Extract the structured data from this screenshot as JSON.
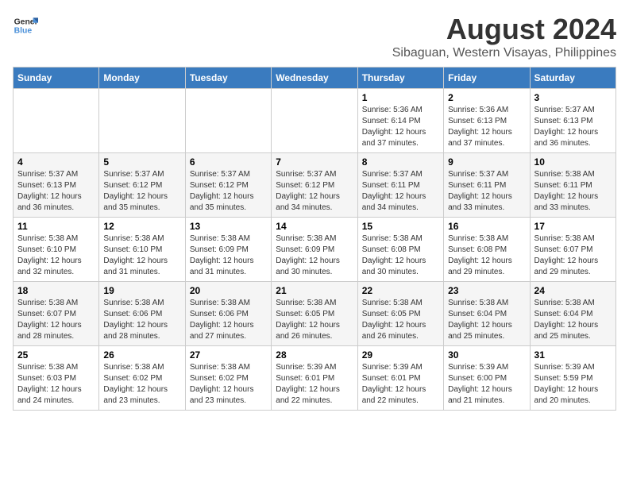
{
  "header": {
    "logo_line1": "General",
    "logo_line2": "Blue",
    "main_title": "August 2024",
    "subtitle": "Sibaguan, Western Visayas, Philippines"
  },
  "days_of_week": [
    "Sunday",
    "Monday",
    "Tuesday",
    "Wednesday",
    "Thursday",
    "Friday",
    "Saturday"
  ],
  "weeks": [
    [
      {
        "day": "",
        "info": ""
      },
      {
        "day": "",
        "info": ""
      },
      {
        "day": "",
        "info": ""
      },
      {
        "day": "",
        "info": ""
      },
      {
        "day": "1",
        "info": "Sunrise: 5:36 AM\nSunset: 6:14 PM\nDaylight: 12 hours\nand 37 minutes."
      },
      {
        "day": "2",
        "info": "Sunrise: 5:36 AM\nSunset: 6:13 PM\nDaylight: 12 hours\nand 37 minutes."
      },
      {
        "day": "3",
        "info": "Sunrise: 5:37 AM\nSunset: 6:13 PM\nDaylight: 12 hours\nand 36 minutes."
      }
    ],
    [
      {
        "day": "4",
        "info": "Sunrise: 5:37 AM\nSunset: 6:13 PM\nDaylight: 12 hours\nand 36 minutes."
      },
      {
        "day": "5",
        "info": "Sunrise: 5:37 AM\nSunset: 6:12 PM\nDaylight: 12 hours\nand 35 minutes."
      },
      {
        "day": "6",
        "info": "Sunrise: 5:37 AM\nSunset: 6:12 PM\nDaylight: 12 hours\nand 35 minutes."
      },
      {
        "day": "7",
        "info": "Sunrise: 5:37 AM\nSunset: 6:12 PM\nDaylight: 12 hours\nand 34 minutes."
      },
      {
        "day": "8",
        "info": "Sunrise: 5:37 AM\nSunset: 6:11 PM\nDaylight: 12 hours\nand 34 minutes."
      },
      {
        "day": "9",
        "info": "Sunrise: 5:37 AM\nSunset: 6:11 PM\nDaylight: 12 hours\nand 33 minutes."
      },
      {
        "day": "10",
        "info": "Sunrise: 5:38 AM\nSunset: 6:11 PM\nDaylight: 12 hours\nand 33 minutes."
      }
    ],
    [
      {
        "day": "11",
        "info": "Sunrise: 5:38 AM\nSunset: 6:10 PM\nDaylight: 12 hours\nand 32 minutes."
      },
      {
        "day": "12",
        "info": "Sunrise: 5:38 AM\nSunset: 6:10 PM\nDaylight: 12 hours\nand 31 minutes."
      },
      {
        "day": "13",
        "info": "Sunrise: 5:38 AM\nSunset: 6:09 PM\nDaylight: 12 hours\nand 31 minutes."
      },
      {
        "day": "14",
        "info": "Sunrise: 5:38 AM\nSunset: 6:09 PM\nDaylight: 12 hours\nand 30 minutes."
      },
      {
        "day": "15",
        "info": "Sunrise: 5:38 AM\nSunset: 6:08 PM\nDaylight: 12 hours\nand 30 minutes."
      },
      {
        "day": "16",
        "info": "Sunrise: 5:38 AM\nSunset: 6:08 PM\nDaylight: 12 hours\nand 29 minutes."
      },
      {
        "day": "17",
        "info": "Sunrise: 5:38 AM\nSunset: 6:07 PM\nDaylight: 12 hours\nand 29 minutes."
      }
    ],
    [
      {
        "day": "18",
        "info": "Sunrise: 5:38 AM\nSunset: 6:07 PM\nDaylight: 12 hours\nand 28 minutes."
      },
      {
        "day": "19",
        "info": "Sunrise: 5:38 AM\nSunset: 6:06 PM\nDaylight: 12 hours\nand 28 minutes."
      },
      {
        "day": "20",
        "info": "Sunrise: 5:38 AM\nSunset: 6:06 PM\nDaylight: 12 hours\nand 27 minutes."
      },
      {
        "day": "21",
        "info": "Sunrise: 5:38 AM\nSunset: 6:05 PM\nDaylight: 12 hours\nand 26 minutes."
      },
      {
        "day": "22",
        "info": "Sunrise: 5:38 AM\nSunset: 6:05 PM\nDaylight: 12 hours\nand 26 minutes."
      },
      {
        "day": "23",
        "info": "Sunrise: 5:38 AM\nSunset: 6:04 PM\nDaylight: 12 hours\nand 25 minutes."
      },
      {
        "day": "24",
        "info": "Sunrise: 5:38 AM\nSunset: 6:04 PM\nDaylight: 12 hours\nand 25 minutes."
      }
    ],
    [
      {
        "day": "25",
        "info": "Sunrise: 5:38 AM\nSunset: 6:03 PM\nDaylight: 12 hours\nand 24 minutes."
      },
      {
        "day": "26",
        "info": "Sunrise: 5:38 AM\nSunset: 6:02 PM\nDaylight: 12 hours\nand 23 minutes."
      },
      {
        "day": "27",
        "info": "Sunrise: 5:38 AM\nSunset: 6:02 PM\nDaylight: 12 hours\nand 23 minutes."
      },
      {
        "day": "28",
        "info": "Sunrise: 5:39 AM\nSunset: 6:01 PM\nDaylight: 12 hours\nand 22 minutes."
      },
      {
        "day": "29",
        "info": "Sunrise: 5:39 AM\nSunset: 6:01 PM\nDaylight: 12 hours\nand 22 minutes."
      },
      {
        "day": "30",
        "info": "Sunrise: 5:39 AM\nSunset: 6:00 PM\nDaylight: 12 hours\nand 21 minutes."
      },
      {
        "day": "31",
        "info": "Sunrise: 5:39 AM\nSunset: 5:59 PM\nDaylight: 12 hours\nand 20 minutes."
      }
    ]
  ]
}
